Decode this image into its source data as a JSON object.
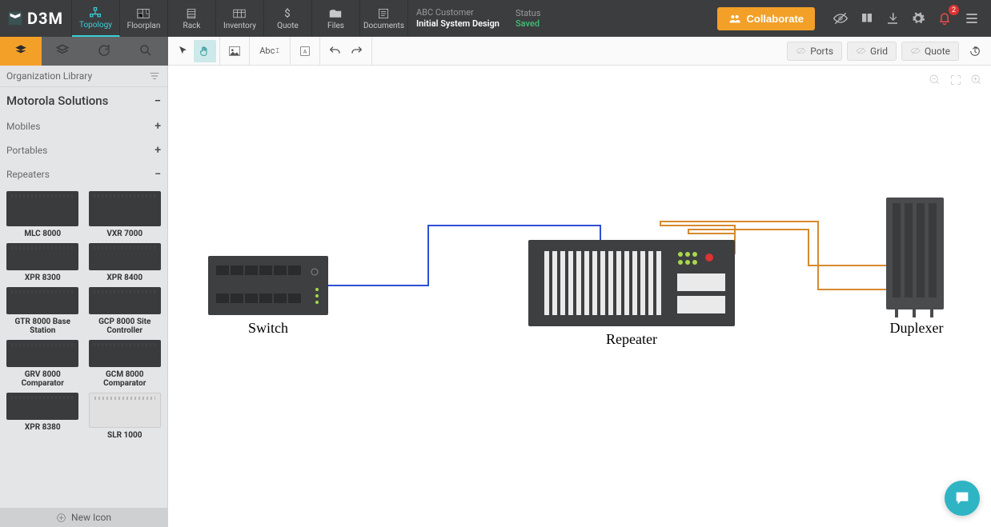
{
  "app": {
    "name": "D3M"
  },
  "nav": {
    "tabs": [
      "Topology",
      "Floorplan",
      "Rack",
      "Inventory",
      "Quote",
      "Files",
      "Documents"
    ],
    "active": 0
  },
  "project": {
    "customer": "ABC Customer",
    "title": "Initial System Design",
    "status_label": "Status",
    "status_value": "Saved"
  },
  "collaborate_label": "Collaborate",
  "notifications": {
    "count": "2"
  },
  "library": {
    "header": "Organization Library",
    "vendor": "Motorola Solutions",
    "categories": [
      {
        "name": "Mobiles",
        "expanded": false
      },
      {
        "name": "Portables",
        "expanded": false
      },
      {
        "name": "Repeaters",
        "expanded": true
      }
    ],
    "devices": [
      "MLC 8000",
      "VXR 7000",
      "XPR 8300",
      "XPR 8400",
      "GTR 8000 Base Station",
      "GCP 8000 Site Controller",
      "GRV 8000 Comparator",
      "GCM 8000 Comparator",
      "XPR 8380",
      "SLR 1000"
    ],
    "new_icon": "New Icon"
  },
  "toolbar": {
    "toggle_labels": [
      "Ports",
      "Grid",
      "Quote"
    ]
  },
  "canvas": {
    "nodes": {
      "switch": "Switch",
      "repeater": "Repeater",
      "duplexer": "Duplexer"
    }
  }
}
